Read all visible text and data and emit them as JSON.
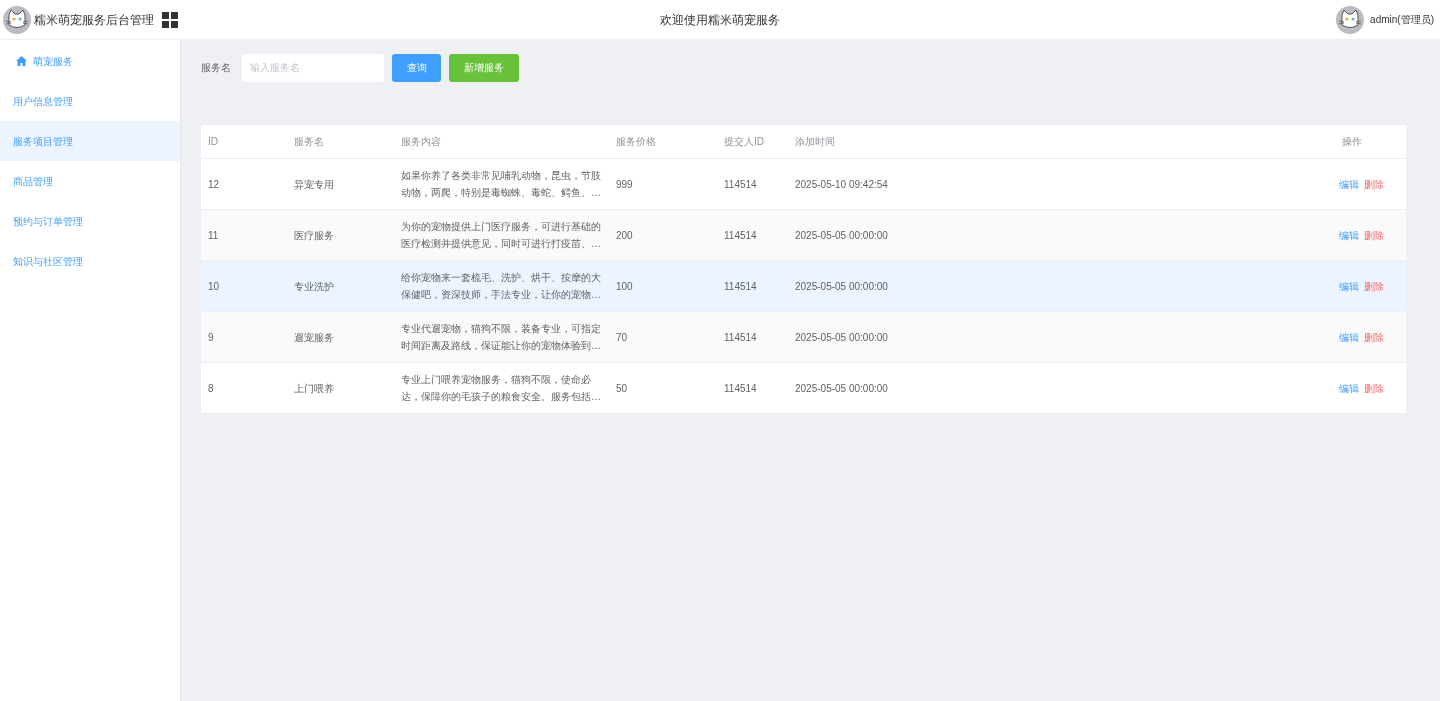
{
  "header": {
    "app_title": "糯米萌宠服务后台管理",
    "welcome": "欢迎使用糯米萌宠服务",
    "user": "admin(管理员)"
  },
  "sidebar": {
    "items": [
      {
        "label": "萌宠服务",
        "kind": "home",
        "selected": false
      },
      {
        "label": "用户信息管理",
        "kind": "plain",
        "selected": false
      },
      {
        "label": "服务项目管理",
        "kind": "plain",
        "selected": true
      },
      {
        "label": "商品管理",
        "kind": "plain",
        "selected": false
      },
      {
        "label": "预约与订单管理",
        "kind": "plain",
        "selected": false
      },
      {
        "label": "知识与社区管理",
        "kind": "plain",
        "selected": false
      }
    ]
  },
  "search": {
    "label": "服务名",
    "placeholder": "输入服务名",
    "query_button": "查询",
    "add_button": "新增服务"
  },
  "table": {
    "columns": [
      "ID",
      "服务名",
      "服务内容",
      "服务价格",
      "提交人ID",
      "添加时间",
      "操作"
    ],
    "rows": [
      {
        "id": "12",
        "name": "异宠专用",
        "content": "如果你养了各类非常见哺乳动物，昆虫，节肢动物，两爬，特别是毒蜘蛛、毒蛇、鳄鱼、…",
        "price": "999",
        "submitter": "114514",
        "time": "2025-05-10 09:42:54",
        "edit": "编辑",
        "delete": "删除",
        "selected": false
      },
      {
        "id": "11",
        "name": "医疗服务",
        "content": "为你的宠物提供上门医疗服务，可进行基础的医疗检测并提供意见，同时可进行打疫苗、…",
        "price": "200",
        "submitter": "114514",
        "time": "2025-05-05 00:00:00",
        "edit": "编辑",
        "delete": "删除",
        "selected": false
      },
      {
        "id": "10",
        "name": "专业洗护",
        "content": "给你宠物来一套梳毛、洗护、烘干、按摩的大保健吧，资深技师，手法专业，让你的宠物…",
        "price": "100",
        "submitter": "114514",
        "time": "2025-05-05 00:00:00",
        "edit": "编辑",
        "delete": "删除",
        "selected": true
      },
      {
        "id": "9",
        "name": "遛宠服务",
        "content": "专业代遛宠物，猫狗不限，装备专业，可指定时间距离及路线，保证能让你的宠物体验到…",
        "price": "70",
        "submitter": "114514",
        "time": "2025-05-05 00:00:00",
        "edit": "编辑",
        "delete": "删除",
        "selected": false
      },
      {
        "id": "8",
        "name": "上门喂养",
        "content": "专业上门喂养宠物服务，猫狗不限，使命必达，保障你的毛孩子的粮食安全。服务包括…",
        "price": "50",
        "submitter": "114514",
        "time": "2025-05-05 00:00:00",
        "edit": "编辑",
        "delete": "删除",
        "selected": false
      }
    ]
  }
}
